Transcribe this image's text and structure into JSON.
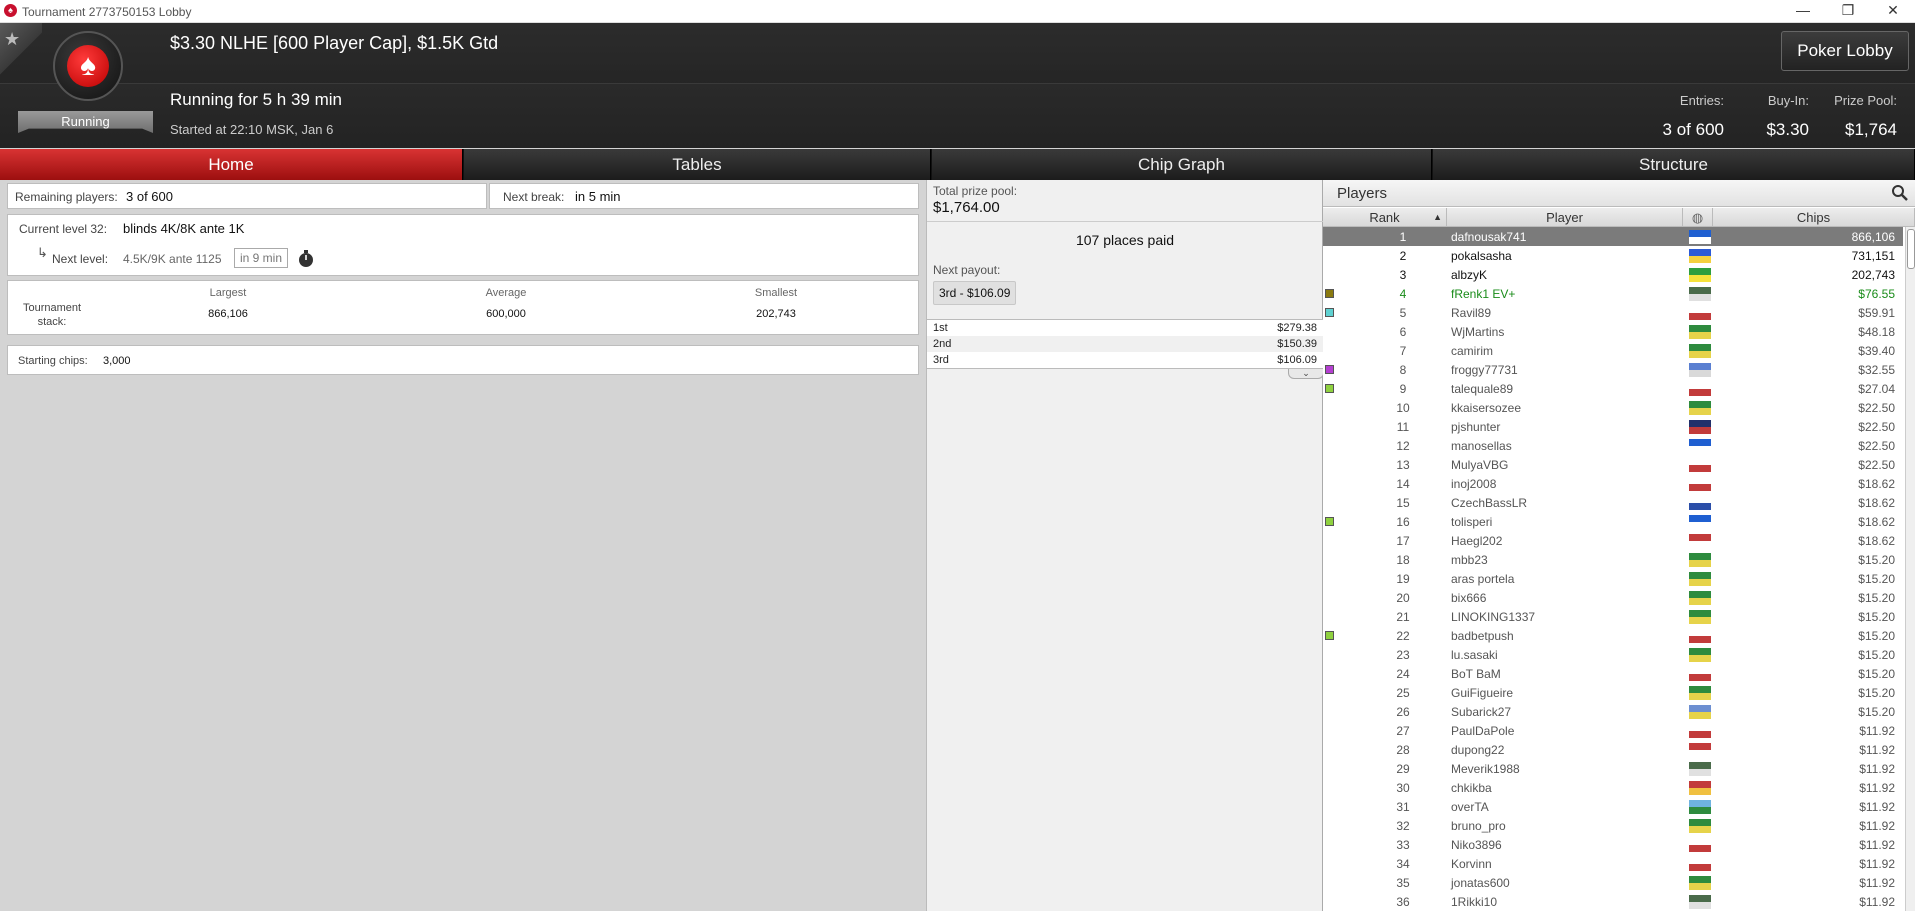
{
  "window": {
    "title": "Tournament 2773750153 Lobby",
    "minimize": "—",
    "restore": "❐",
    "close": "✕"
  },
  "header": {
    "tournament_name": "$3.30 NLHE [600 Player Cap], $1.5K Gtd",
    "status": "Running",
    "running_for": "Running for 5 h 39 min",
    "started_at": "Started at 22:10 MSK, Jan 6",
    "lobby_button": "Poker Lobby",
    "stats": [
      {
        "label": "Entries:",
        "value": "3 of 600"
      },
      {
        "label": "Buy-In:",
        "value": "$3.30"
      },
      {
        "label": "Prize Pool:",
        "value": "$1,764"
      }
    ]
  },
  "tabs": [
    "Home",
    "Tables",
    "Chip Graph",
    "Structure"
  ],
  "home": {
    "remaining_label": "Remaining players:",
    "remaining_value": "3 of 600",
    "break_label": "Next break:",
    "break_value": "in 5 min",
    "level_label": "Current level 32:",
    "level_value": "blinds 4K/8K ante 1K",
    "next_level_label": "Next level:",
    "next_level_value": "4.5K/9K ante 1125",
    "next_level_time": "in 9 min",
    "stack_label": "Tournament stack:",
    "stack_headers": [
      "Largest",
      "Average",
      "Smallest"
    ],
    "stack_values": [
      "866,106",
      "600,000",
      "202,743"
    ],
    "starting_label": "Starting chips:",
    "starting_value": "3,000"
  },
  "prize": {
    "pool_label": "Total prize pool:",
    "pool_value": "$1,764.00",
    "places_paid": "107 places paid",
    "next_payout_label": "Next payout:",
    "next_payout_value": "3rd - $106.09",
    "payouts": [
      {
        "place": "1st",
        "amount": "$279.38"
      },
      {
        "place": "2nd",
        "amount": "$150.39"
      },
      {
        "place": "3rd",
        "amount": "$106.09"
      }
    ]
  },
  "players": {
    "title": "Players",
    "headers": {
      "rank": "Rank",
      "player": "Player",
      "chips": "Chips"
    },
    "rows": [
      {
        "rank": "1",
        "name": "dafnousak741",
        "chips": "866,106",
        "flag": [
          "#1f5fd1",
          "#ffffff"
        ]
      },
      {
        "rank": "2",
        "name": "pokalsasha",
        "chips": "731,151",
        "flag": [
          "#2b5ad6",
          "#f4d03f"
        ]
      },
      {
        "rank": "3",
        "name": "albzyK",
        "chips": "202,743",
        "flag": [
          "#2e9e3e",
          "#f6e23b"
        ]
      },
      {
        "rank": "4",
        "name": "fRenk1 EV+",
        "chips": "$76.55",
        "flag": [
          "#4a6b4a",
          "#e0e0e0"
        ],
        "marker": "#8a7a10"
      },
      {
        "rank": "5",
        "name": "Ravil89",
        "chips": "$59.91",
        "flag": [
          "#ffffff",
          "#c23b3b"
        ],
        "marker": "#5fd1d1"
      },
      {
        "rank": "6",
        "name": "WjMartins",
        "chips": "$48.18",
        "flag": [
          "#2e8b3e",
          "#e6d34a"
        ]
      },
      {
        "rank": "7",
        "name": "camirim",
        "chips": "$39.40",
        "flag": [
          "#2e8b3e",
          "#e6d34a"
        ]
      },
      {
        "rank": "8",
        "name": "froggy77731",
        "chips": "$32.55",
        "flag": [
          "#5a7fd1",
          "#d9d9d9"
        ],
        "marker": "#b43fd1"
      },
      {
        "rank": "9",
        "name": "talequale89",
        "chips": "$27.04",
        "flag": [
          "#ffffff",
          "#c23b3b"
        ],
        "marker": "#8fd13f"
      },
      {
        "rank": "10",
        "name": "kkaisersozee",
        "chips": "$22.50",
        "flag": [
          "#2e8b3e",
          "#e6d34a"
        ]
      },
      {
        "rank": "11",
        "name": "pjshunter",
        "chips": "$22.50",
        "flag": [
          "#22306b",
          "#c23b3b"
        ]
      },
      {
        "rank": "12",
        "name": "manosellas",
        "chips": "$22.50",
        "flag": [
          "#1f5fd1",
          "#ffffff"
        ]
      },
      {
        "rank": "13",
        "name": "MulyaVBG",
        "chips": "$22.50",
        "flag": [
          "#ffffff",
          "#c23b3b"
        ]
      },
      {
        "rank": "14",
        "name": "inoj2008",
        "chips": "$18.62",
        "flag": [
          "#ffffff",
          "#c23b3b"
        ]
      },
      {
        "rank": "15",
        "name": "CzechBassLR",
        "chips": "$18.62",
        "flag": [
          "#ffffff",
          "#2b4ea8"
        ]
      },
      {
        "rank": "16",
        "name": "tolisperi",
        "chips": "$18.62",
        "flag": [
          "#1f5fd1",
          "#ffffff"
        ],
        "marker": "#8fd13f"
      },
      {
        "rank": "17",
        "name": "Haegl202",
        "chips": "$18.62",
        "flag": [
          "#c23b3b",
          "#ffffff"
        ]
      },
      {
        "rank": "18",
        "name": "mbb23",
        "chips": "$15.20",
        "flag": [
          "#2e8b3e",
          "#e6d34a"
        ]
      },
      {
        "rank": "19",
        "name": "aras portela",
        "chips": "$15.20",
        "flag": [
          "#2e8b3e",
          "#e6d34a"
        ]
      },
      {
        "rank": "20",
        "name": "bix666",
        "chips": "$15.20",
        "flag": [
          "#2e8b3e",
          "#e6d34a"
        ]
      },
      {
        "rank": "21",
        "name": "LINOKING1337",
        "chips": "$15.20",
        "flag": [
          "#2e8b3e",
          "#e6d34a"
        ]
      },
      {
        "rank": "22",
        "name": "badbetpush",
        "chips": "$15.20",
        "flag": [
          "#ffffff",
          "#c23b3b"
        ],
        "marker": "#8fd13f"
      },
      {
        "rank": "23",
        "name": "lu.sasaki",
        "chips": "$15.20",
        "flag": [
          "#2e8b3e",
          "#e6d34a"
        ]
      },
      {
        "rank": "24",
        "name": "BoT BaM",
        "chips": "$15.20",
        "flag": [
          "#ffffff",
          "#c23b3b"
        ]
      },
      {
        "rank": "25",
        "name": "GuiFigueire",
        "chips": "$15.20",
        "flag": [
          "#2e8b3e",
          "#e6d34a"
        ]
      },
      {
        "rank": "26",
        "name": "Subarick27",
        "chips": "$15.20",
        "flag": [
          "#6d8fd1",
          "#e6d34a"
        ]
      },
      {
        "rank": "27",
        "name": "PaulDaPole",
        "chips": "$11.92",
        "flag": [
          "#ffffff",
          "#c23b3b"
        ]
      },
      {
        "rank": "28",
        "name": "dupong22",
        "chips": "$11.92",
        "flag": [
          "#c23b3b",
          "#ffffff"
        ]
      },
      {
        "rank": "29",
        "name": "Meverik1988",
        "chips": "$11.92",
        "flag": [
          "#4a6b4a",
          "#e0e0e0"
        ]
      },
      {
        "rank": "30",
        "name": "chkikba",
        "chips": "$11.92",
        "flag": [
          "#c23b3b",
          "#f0c040"
        ]
      },
      {
        "rank": "31",
        "name": "overTA",
        "chips": "$11.92",
        "flag": [
          "#6fb3e0",
          "#2e8b3e"
        ]
      },
      {
        "rank": "32",
        "name": "bruno_pro",
        "chips": "$11.92",
        "flag": [
          "#2e8b3e",
          "#e6d34a"
        ]
      },
      {
        "rank": "33",
        "name": "Niko3896",
        "chips": "$11.92",
        "flag": [
          "#ffffff",
          "#c23b3b"
        ]
      },
      {
        "rank": "34",
        "name": "Korvinn",
        "chips": "$11.92",
        "flag": [
          "#ffffff",
          "#c23b3b"
        ]
      },
      {
        "rank": "35",
        "name": "jonatas600",
        "chips": "$11.92",
        "flag": [
          "#2e8b3e",
          "#e6d34a"
        ]
      },
      {
        "rank": "36",
        "name": "1Rikki10",
        "chips": "$11.92",
        "flag": [
          "#4a6b4a",
          "#e0e0e0"
        ]
      }
    ]
  }
}
